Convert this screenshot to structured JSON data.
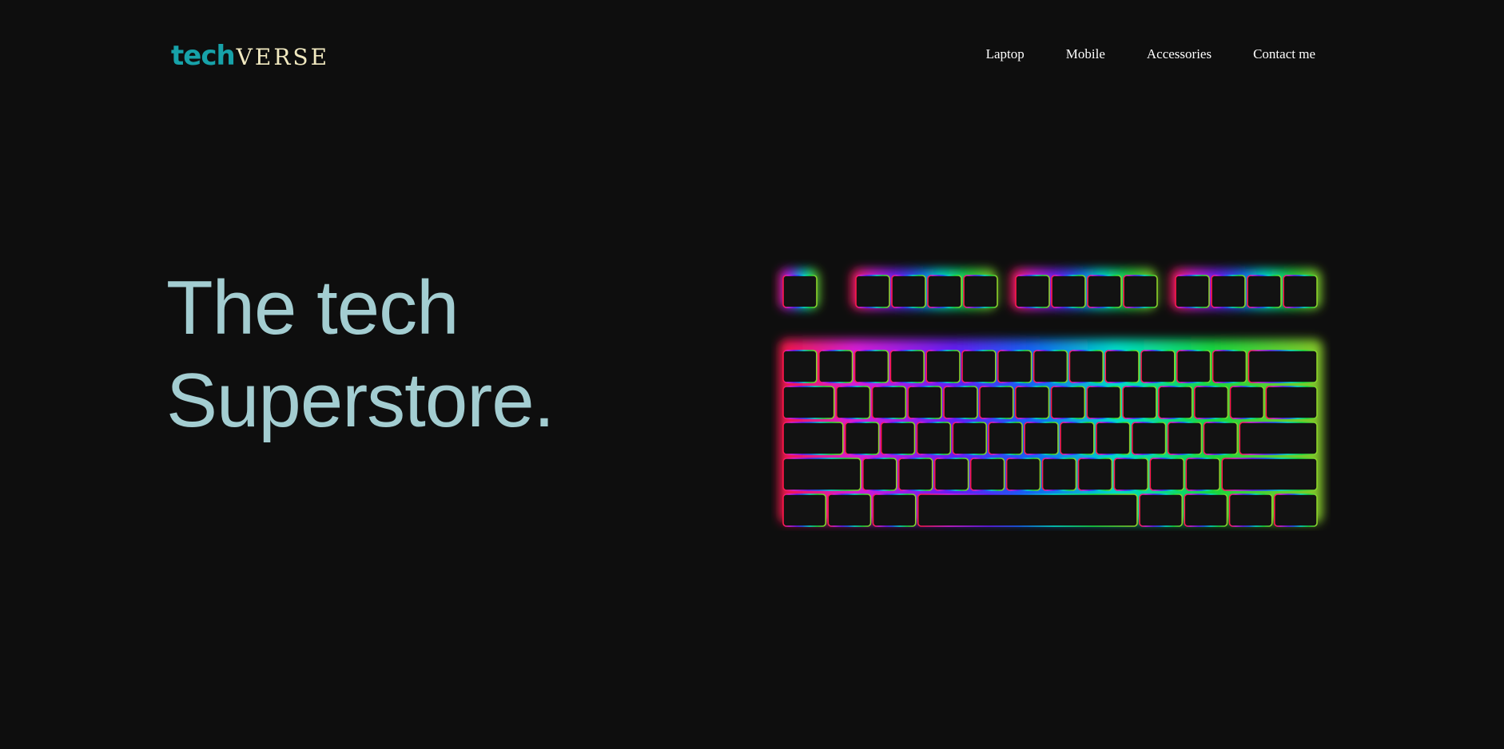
{
  "brand": {
    "tech": "tech",
    "verse": "VERSE",
    "tech_color": "#17a2a9",
    "verse_color": "#f1e9c0"
  },
  "nav": {
    "items": [
      "Laptop",
      "Mobile",
      "Accessories",
      "Contact me"
    ]
  },
  "hero": {
    "line1": "The tech",
    "line2": "Superstore.",
    "color": "#a3cdd1"
  },
  "keyboard_image": {
    "icon": "rgb-keyboard-icon",
    "glow_colors": [
      "#ff1744",
      "#e020e0",
      "#6a1bff",
      "#1565ff",
      "#00e5d0",
      "#18e040",
      "#8fd12a"
    ]
  }
}
